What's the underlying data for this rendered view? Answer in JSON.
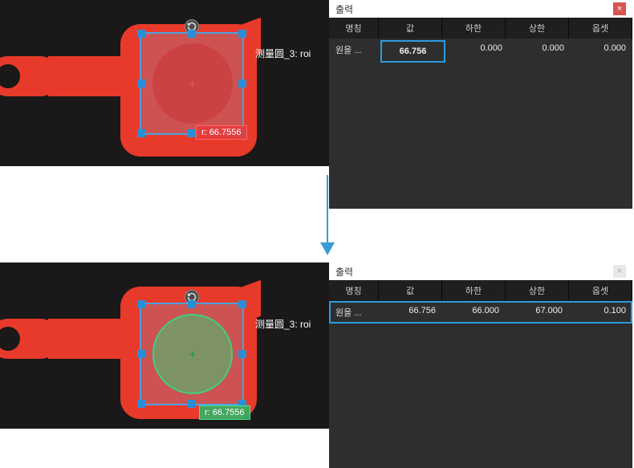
{
  "top": {
    "vision": {
      "roi_label": "测量圆_3: roi",
      "radius_tag": "r: 66.7556"
    },
    "output": {
      "title": "출력",
      "close_icon": "×",
      "headers": {
        "name": "명칭",
        "value": "값",
        "lower": "하한",
        "upper": "상한",
        "offset": "옵셋"
      },
      "row": {
        "name": "원을 ...",
        "value": "66.756",
        "lower": "0.000",
        "upper": "0.000",
        "offset": "0.000"
      }
    }
  },
  "bottom": {
    "vision": {
      "roi_label": "测量圆_3: roi",
      "radius_tag": "r: 66.7556"
    },
    "output": {
      "title": "출력",
      "close_icon": "×",
      "headers": {
        "name": "명칭",
        "value": "값",
        "lower": "하한",
        "upper": "상한",
        "offset": "옵셋"
      },
      "row": {
        "name": "원을 ...",
        "value": "66.756",
        "lower": "66.000",
        "upper": "67.000",
        "offset": "0.100"
      }
    }
  }
}
